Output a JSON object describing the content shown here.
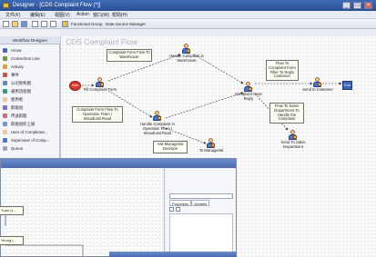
{
  "window": {
    "title": "Designer - [CDS Complaint Flow (*)]",
    "controls": [
      "_",
      "□",
      "×"
    ]
  },
  "menu": [
    "文件(F)",
    "编辑(E)",
    "视图(V)",
    "Action",
    "窗口(W)",
    "帮助(H)"
  ],
  "toolbar": {
    "functional_group": "Functional Group",
    "data_source_manager": "Data Source Manager"
  },
  "toolbox": {
    "header": "Workflow Designer",
    "items": [
      "Arrow",
      "Connection Line",
      "Activity",
      "事件",
      "公司架构图",
      "通用流程图",
      "使用者",
      "职能组",
      "传送职能",
      "职能组织上级",
      "User of Completed...",
      "Supervisor of Comp...",
      "Queue"
    ]
  },
  "canvas": {
    "title": "CDS Complaint Flow",
    "start_label": "Start",
    "end_label": "End",
    "nodes": {
      "fill_complaint": "Fill Complaint Form",
      "handle_warehouse": "Handle Complaint in Warehouse",
      "handle_operation": "Handle Complaint In Operation Team / Broadcast Road",
      "to_managerial": "To Managerial",
      "complaint_case_reply": "Complaint Case Reply",
      "send_to_customer": "Send to Customer",
      "send_to_sales": "Send To Sales Department"
    },
    "notes": {
      "form_to_warehouse": "Complaint Form Flow To Warehouse",
      "form_to_operation": "Complaint Form Flow To Operation Team / Broadcast Road",
      "ask_managerial": "Ask Managerial Decision",
      "flow_to_reply": "Flow To Complaint Form Filler To Reply Customer",
      "flow_to_sales": "Flow To Sales Department To Handle the Complaint"
    }
  },
  "sub_window": {
    "org_boxes": [
      "Yuan (L...",
      "Yeung (..."
    ],
    "properties": {
      "tab_properties": "Properties",
      "tab_variable": "Variable"
    }
  }
}
